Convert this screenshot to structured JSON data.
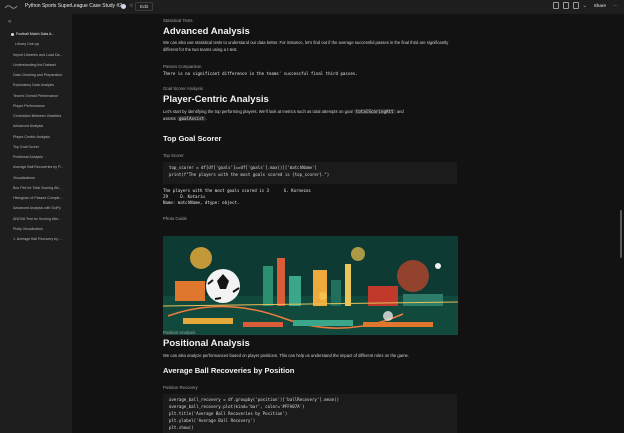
{
  "app": {
    "doc_title": "Python Sports SuperLeague Case Study #2",
    "edit_label": "Edit",
    "share_label": "Share"
  },
  "sidebar": {
    "items": [
      {
        "label": "Football Match Data A...",
        "active": true
      },
      {
        "label": "Library Line-up",
        "sub": true
      },
      {
        "label": "Import Libraries and Load Da..."
      },
      {
        "label": "Understanding the Dataset"
      },
      {
        "label": "Data Cleaning and Preparation"
      },
      {
        "label": "Exploratory Data Analysis"
      },
      {
        "label": "Team's Overall Performance"
      },
      {
        "label": "Player Performance"
      },
      {
        "label": "Correlation Between Variables"
      },
      {
        "label": "Advanced Analysis"
      },
      {
        "label": "Player-Centric Analysis"
      },
      {
        "label": "Top Goal Scorer"
      },
      {
        "label": "Positional Analysis"
      },
      {
        "label": "Average Ball Recoveries by P..."
      },
      {
        "label": "Visualizations"
      },
      {
        "label": "Box Plot for Total Scoring Att..."
      },
      {
        "label": "Histogram of Passes Comple..."
      },
      {
        "label": "Advanced Analysis with SciPy"
      },
      {
        "label": "ANOVA Test for Scoring Atte..."
      },
      {
        "label": "Plotly Visualization"
      },
      {
        "label": "1. Average Ball Recovery by ..."
      }
    ]
  },
  "main": {
    "stat_tests_label": "Statistical Tests",
    "advanced_title": "Advanced Analysis",
    "advanced_text": "We can also use statistical tests to understand our data better. For instance, let's find out if the average successful passes in the final third are significantly different for the two teams using a t-test.",
    "passes_label": "Passes Comparison",
    "passes_output": "There is no significant difference in the teams' successful final third passes.",
    "goal_label": "Goal Scorer Analysis",
    "player_title": "Player-Centric Analysis",
    "player_text_a": "Let's start by identifying the top performing players. We'll look at metrics such as total attempts on goal",
    "player_chip_a": "totalScoringAtt",
    "player_text_b": "and",
    "player_text_c": "assists",
    "player_chip_b": "goalAssist",
    "player_text_d": ".",
    "top_title": "Top Goal Scorer",
    "top_label": "Top Scorer",
    "code1_line1": "top_scorer = df[df['goals']==df['goals'].max()]['matchName']",
    "code1_line2": "print(f\"The players with the most goals scored is {top_scorer}.\")",
    "out_line1": "The players with the most goals scored is 3      G. Kornezos",
    "out_line2": "29     D. Kotariu",
    "out_line3": "Name: matchName, dtype: object.",
    "photo_label": "Photo Guide",
    "position_label": "Position Analysis",
    "positional_title": "Positional Analysis",
    "positional_text": "We can also analyze performances based on player positions. This can help us understand the impact of different roles on the game.",
    "recovery_title": "Average Ball Recoveries by Position",
    "recovery_label": "Position Recovery",
    "code2_line1": "average_ball_recovery = df.groupby('position')['ballRecovery'].mean()",
    "code2_line2": "average_ball_recovery.plot(kind='bar', color='#FFA07A')",
    "code2_line3": "plt.title('Average Ball Recoveries by Position')",
    "code2_line4": "plt.ylabel('Average Ball Recovery')",
    "code2_line5": "plt.show()"
  },
  "colors": {
    "accent": "#f25f5c",
    "background": "#121212",
    "sidebar": "#1e1e1f"
  }
}
